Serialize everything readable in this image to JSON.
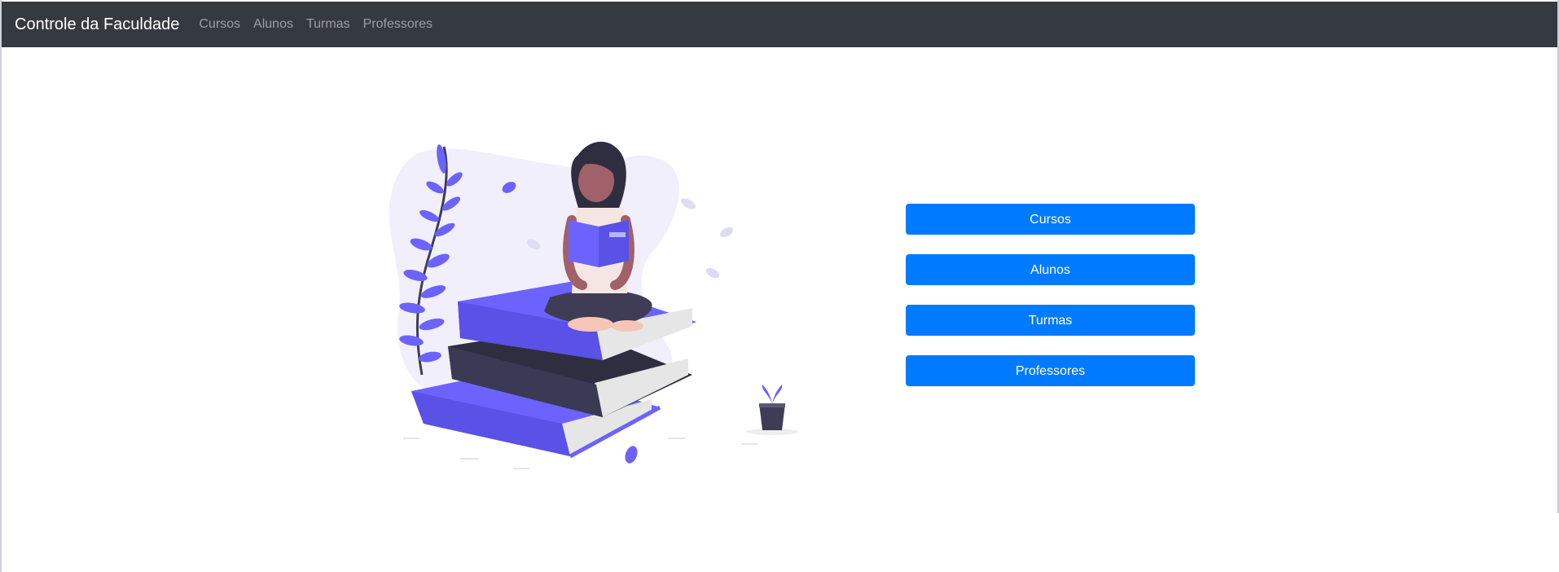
{
  "navbar": {
    "brand": "Controle da Faculdade",
    "links": [
      "Cursos",
      "Alunos",
      "Turmas",
      "Professores"
    ]
  },
  "actions": {
    "buttons": [
      "Cursos",
      "Alunos",
      "Turmas",
      "Professores"
    ]
  },
  "illustration": {
    "icon": "woman-reading-on-books-illustration"
  },
  "colors": {
    "navbar_bg": "#343a40",
    "button_primary": "#007bff",
    "accent_purple": "#6c63ff",
    "dark_book": "#2f2e41"
  }
}
